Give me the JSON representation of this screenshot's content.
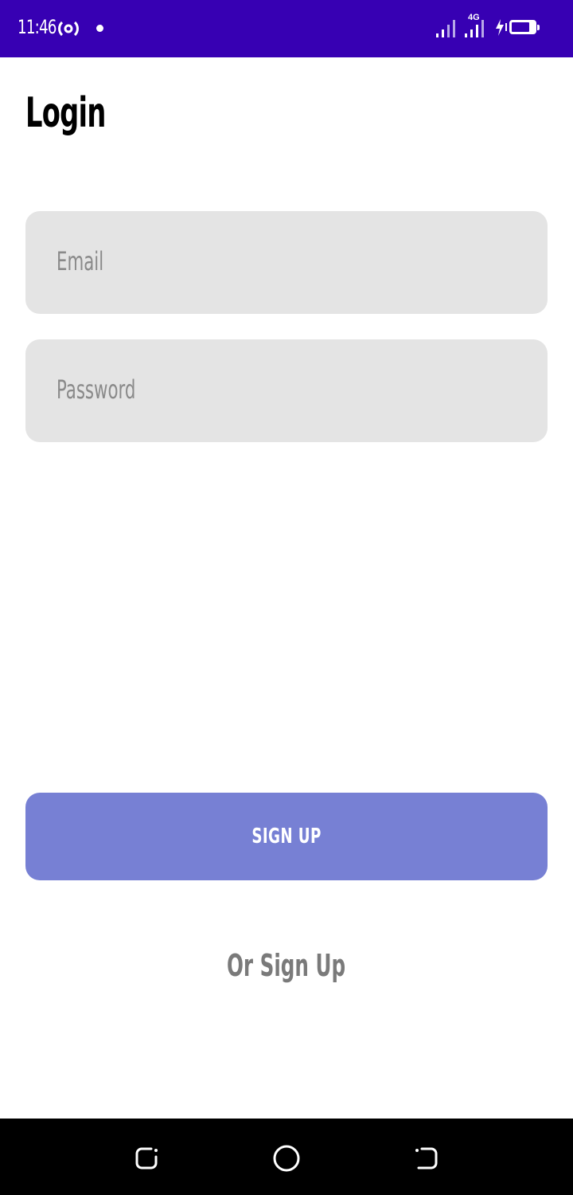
{
  "status_bar": {
    "time": "11:46",
    "network": "4G",
    "battery": "78",
    "icons": [
      "hotspot-icon",
      "notification-dot-icon",
      "signal-icon",
      "signal-icon",
      "charging-bolt-icon",
      "battery-icon"
    ],
    "background_color": "#3700b3"
  },
  "screen": {
    "title": "Login"
  },
  "form": {
    "email_placeholder": "Email",
    "password_placeholder": "Password",
    "field_color": "#e4e4e4"
  },
  "actions": {
    "primary_label": "SIGN UP",
    "primary_color": "#7780d4",
    "secondary_label": "Or Sign Up"
  },
  "nav_bar": {
    "icons": [
      "recent-apps-icon",
      "home-icon",
      "back-icon"
    ]
  }
}
